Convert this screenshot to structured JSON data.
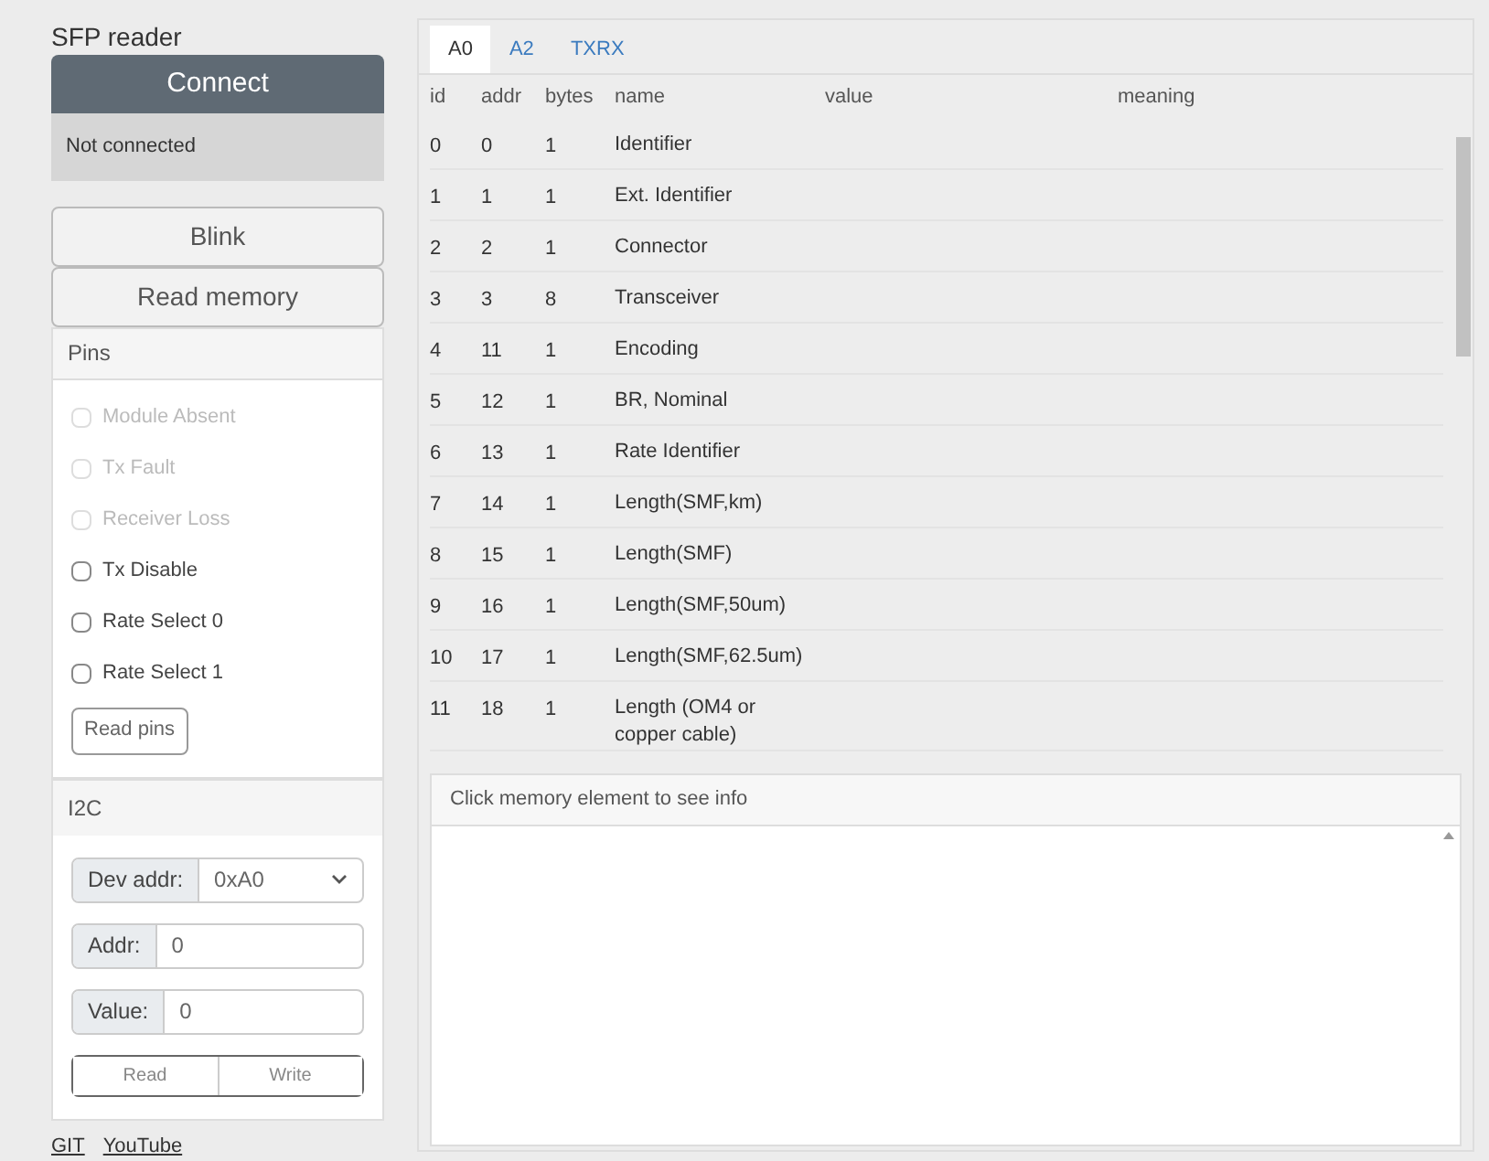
{
  "app_title": "SFP reader",
  "connect_button": "Connect",
  "status": "Not connected",
  "buttons": [
    "Blink",
    "Read memory"
  ],
  "pins": {
    "title": "Pins",
    "items": [
      {
        "label": "Module Absent",
        "checked": false,
        "disabled": true
      },
      {
        "label": "Tx Fault",
        "checked": false,
        "disabled": true
      },
      {
        "label": "Receiver Loss",
        "checked": false,
        "disabled": true
      },
      {
        "label": "Tx Disable",
        "checked": false,
        "disabled": false
      },
      {
        "label": "Rate Select 0",
        "checked": false,
        "disabled": false
      },
      {
        "label": "Rate Select 1",
        "checked": false,
        "disabled": false
      }
    ],
    "read_button": "Read pins"
  },
  "i2c": {
    "title": "I2C",
    "dev_addr": {
      "label": "Dev addr:",
      "value": "0xA0"
    },
    "addr": {
      "label": "Addr:",
      "value": "0"
    },
    "value": {
      "label": "Value:",
      "value": "0"
    },
    "actions": [
      "Read",
      "Write"
    ]
  },
  "links": [
    "GIT",
    "YouTube"
  ],
  "tabs": [
    {
      "label": "A0",
      "selected": true
    },
    {
      "label": "A2",
      "selected": false
    },
    {
      "label": "TXRX",
      "selected": false
    }
  ],
  "table": {
    "columns": [
      "id",
      "addr",
      "bytes",
      "name",
      "value",
      "meaning"
    ],
    "rows": [
      [
        "0",
        "0",
        "1",
        "Identifier"
      ],
      [
        "1",
        "1",
        "1",
        "Ext. Identifier"
      ],
      [
        "2",
        "2",
        "1",
        "Connector"
      ],
      [
        "3",
        "3",
        "8",
        "Transceiver"
      ],
      [
        "4",
        "11",
        "1",
        "Encoding"
      ],
      [
        "5",
        "12",
        "1",
        "BR, Nominal"
      ],
      [
        "6",
        "13",
        "1",
        "Rate Identifier"
      ],
      [
        "7",
        "14",
        "1",
        "Length(SMF,km)"
      ],
      [
        "8",
        "15",
        "1",
        "Length(SMF)"
      ],
      [
        "9",
        "16",
        "1",
        "Length(SMF,50um)"
      ],
      [
        "10",
        "17",
        "1",
        "Length(SMF,62.5um)"
      ],
      [
        "11",
        "18",
        "1",
        "Length (OM4 or copper cable)"
      ]
    ]
  },
  "info": {
    "title": "Click memory element to see info"
  }
}
